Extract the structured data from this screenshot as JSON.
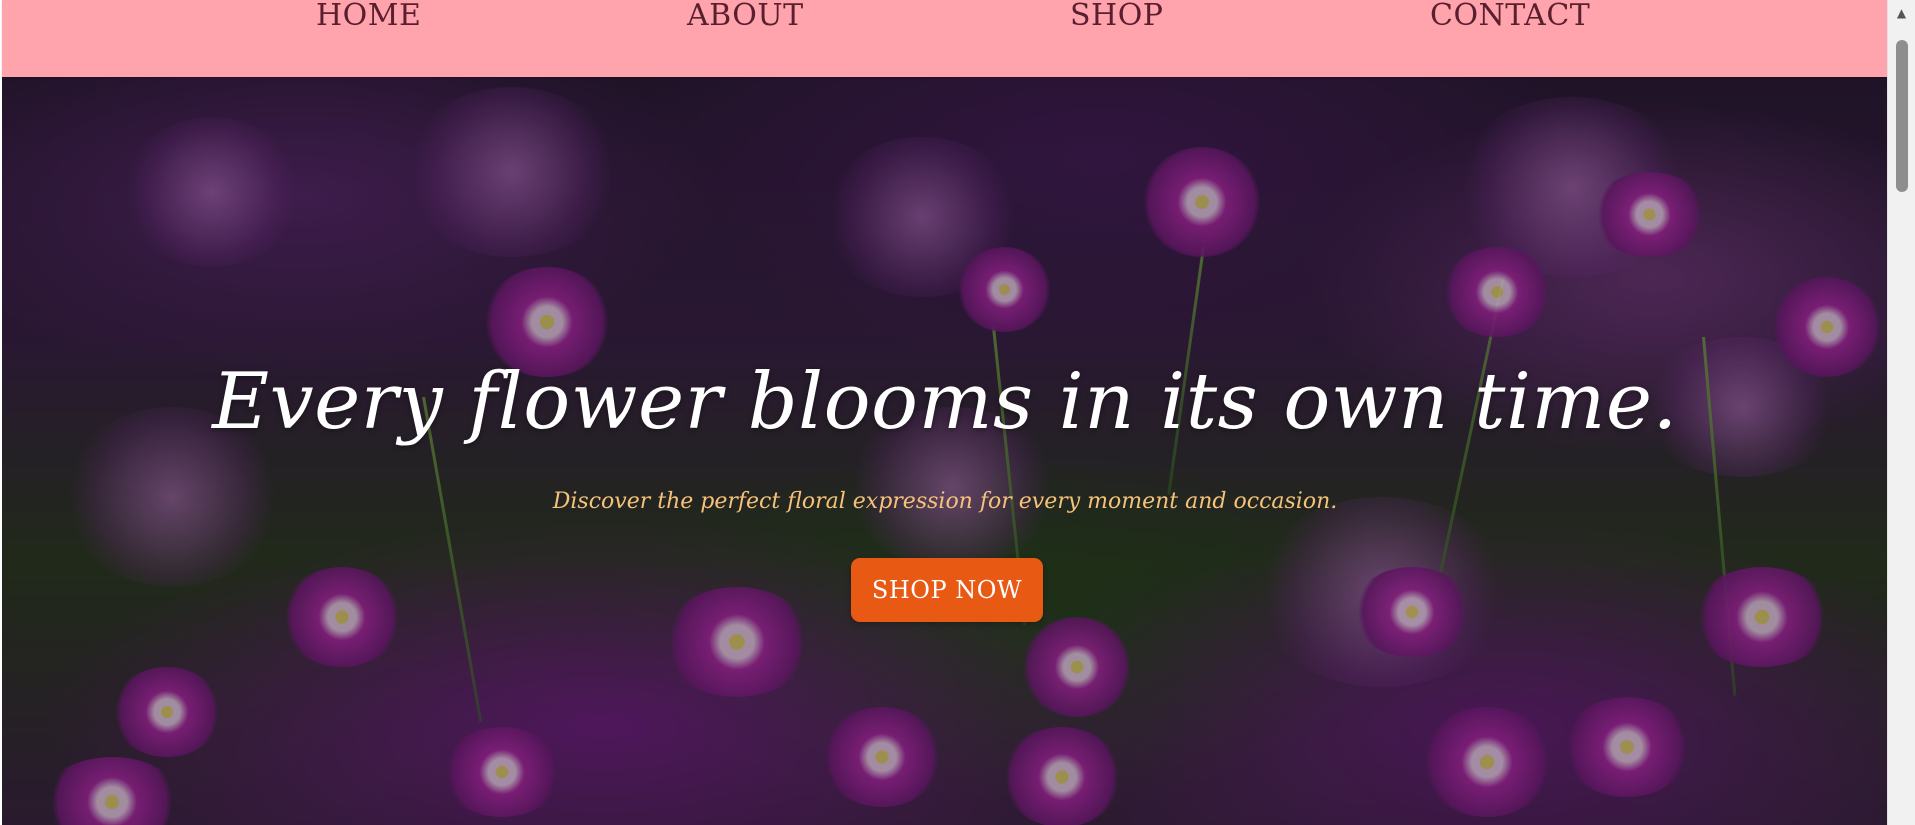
{
  "nav": {
    "home": "HOME",
    "about": "ABOUT",
    "shop": "SHOP",
    "contact": "CONTACT"
  },
  "hero": {
    "title": "Every flower blooms in its own time.",
    "subtitle": "Discover the perfect floral expression for every moment and occasion.",
    "cta_label": "SHOP NOW"
  },
  "icons": {
    "scroll_up": "scroll-up-arrow-icon"
  },
  "colors": {
    "nav_background": "#ffa3ad",
    "nav_text": "#5a1f2e",
    "title_text": "#ffffff",
    "subtitle_text": "#f6c27a",
    "cta_background": "#e85a14",
    "cta_text": "#ffffff"
  }
}
